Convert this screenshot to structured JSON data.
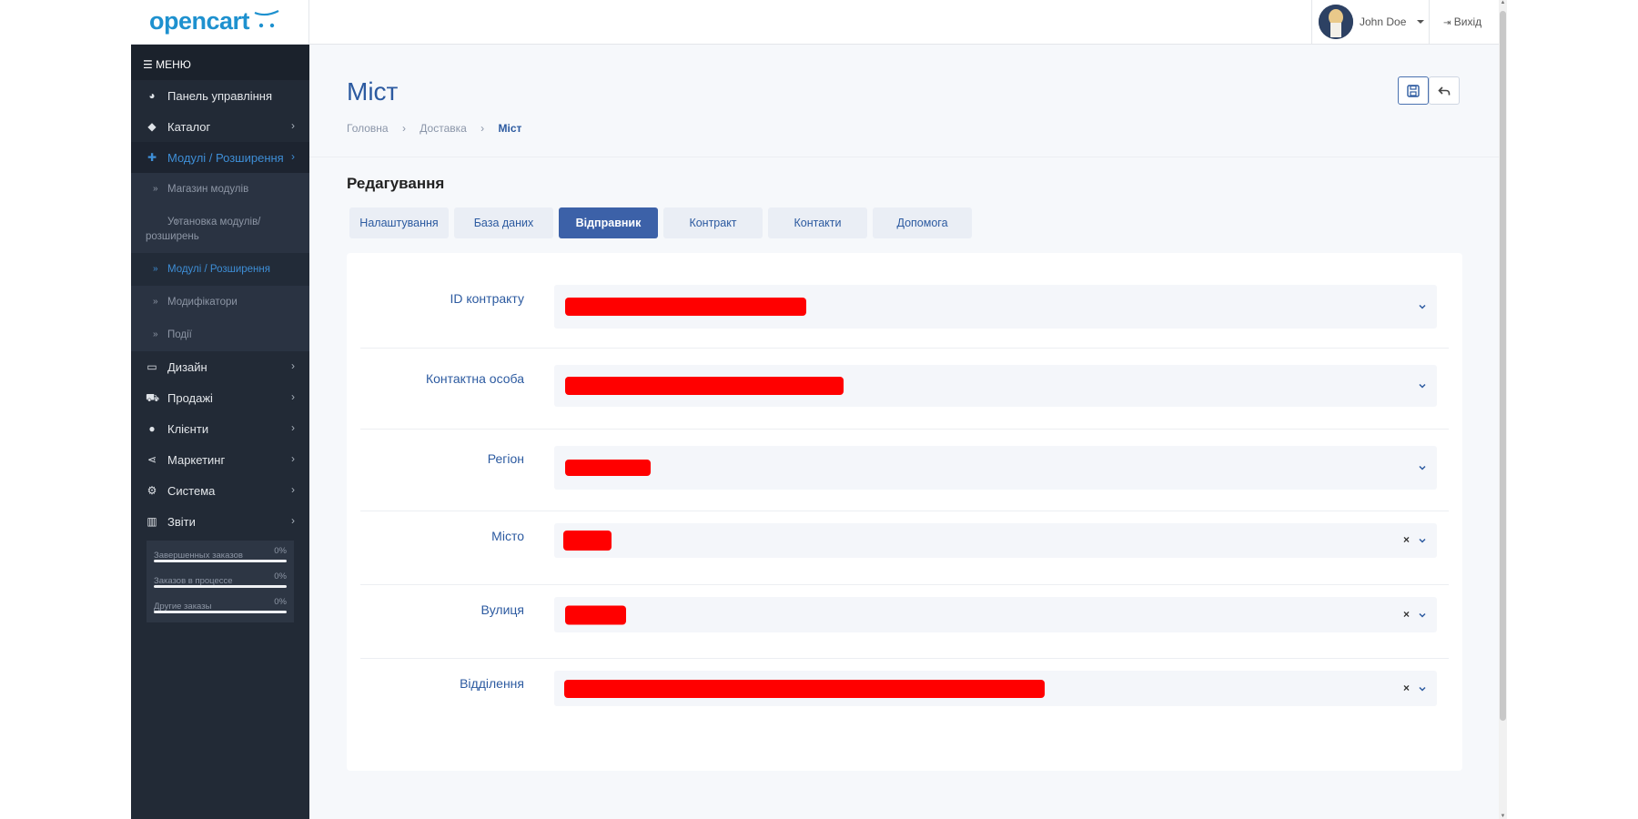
{
  "header": {
    "logo_text": "opencart",
    "user_name": "John Doe",
    "logout_label": "Вихід"
  },
  "sidebar": {
    "menu_label": "МЕНЮ",
    "items": [
      {
        "label": "Панель управління",
        "icon": "dashboard-icon"
      },
      {
        "label": "Каталог",
        "icon": "tags-icon"
      },
      {
        "label": "Модулі / Розширення",
        "icon": "puzzle-icon"
      },
      {
        "label": "Дизайн",
        "icon": "desktop-icon"
      },
      {
        "label": "Продажі",
        "icon": "cart-icon"
      },
      {
        "label": "Клієнти",
        "icon": "user-icon"
      },
      {
        "label": "Маркетинг",
        "icon": "share-icon"
      },
      {
        "label": "Система",
        "icon": "gear-icon"
      },
      {
        "label": "Звіти",
        "icon": "bar-chart-icon"
      }
    ],
    "subitems": [
      {
        "label": "Магазин модулів"
      },
      {
        "label": "Установка модулів/ розширень"
      },
      {
        "label": "Модулі / Розширення"
      },
      {
        "label": "Модифікатори"
      },
      {
        "label": "Події"
      }
    ],
    "stats": [
      {
        "label": "Завершенных заказов",
        "value": "0%",
        "progress": 0
      },
      {
        "label": "Заказов в процессе",
        "value": "0%",
        "progress": 0
      },
      {
        "label": "Другие заказы",
        "value": "0%",
        "progress": 0
      }
    ]
  },
  "page": {
    "title": "Міст",
    "breadcrumb": [
      "Головна",
      "Доставка",
      "Міст"
    ],
    "section_title": "Редагування"
  },
  "tabs": [
    {
      "label": "Налаштування",
      "active": false
    },
    {
      "label": "База даних",
      "active": false
    },
    {
      "label": "Відправник",
      "active": true
    },
    {
      "label": "Контракт",
      "active": false
    },
    {
      "label": "Контакти",
      "active": false
    },
    {
      "label": "Допомога",
      "active": false
    }
  ],
  "form": {
    "fields": [
      {
        "label": "ID контракту",
        "value": "",
        "redacted": true,
        "clearable": false
      },
      {
        "label": "Контактна особа",
        "value": "",
        "redacted": true,
        "clearable": false
      },
      {
        "label": "Регіон",
        "value": "",
        "redacted": true,
        "clearable": false
      },
      {
        "label": "Місто",
        "value": "",
        "redacted": true,
        "clearable": true,
        "clear_glyph": "×"
      },
      {
        "label": "Вулиця",
        "value": "",
        "redacted": true,
        "clearable": true,
        "clear_glyph": "×"
      },
      {
        "label": "Відділення",
        "value": "",
        "redacted": true,
        "clearable": true,
        "clear_glyph": "×"
      }
    ]
  },
  "colors": {
    "accent": "#2c5aa0",
    "sidebar_bg": "#222a36",
    "active_tab": "#3c61a8",
    "redaction": "#ff0000"
  }
}
